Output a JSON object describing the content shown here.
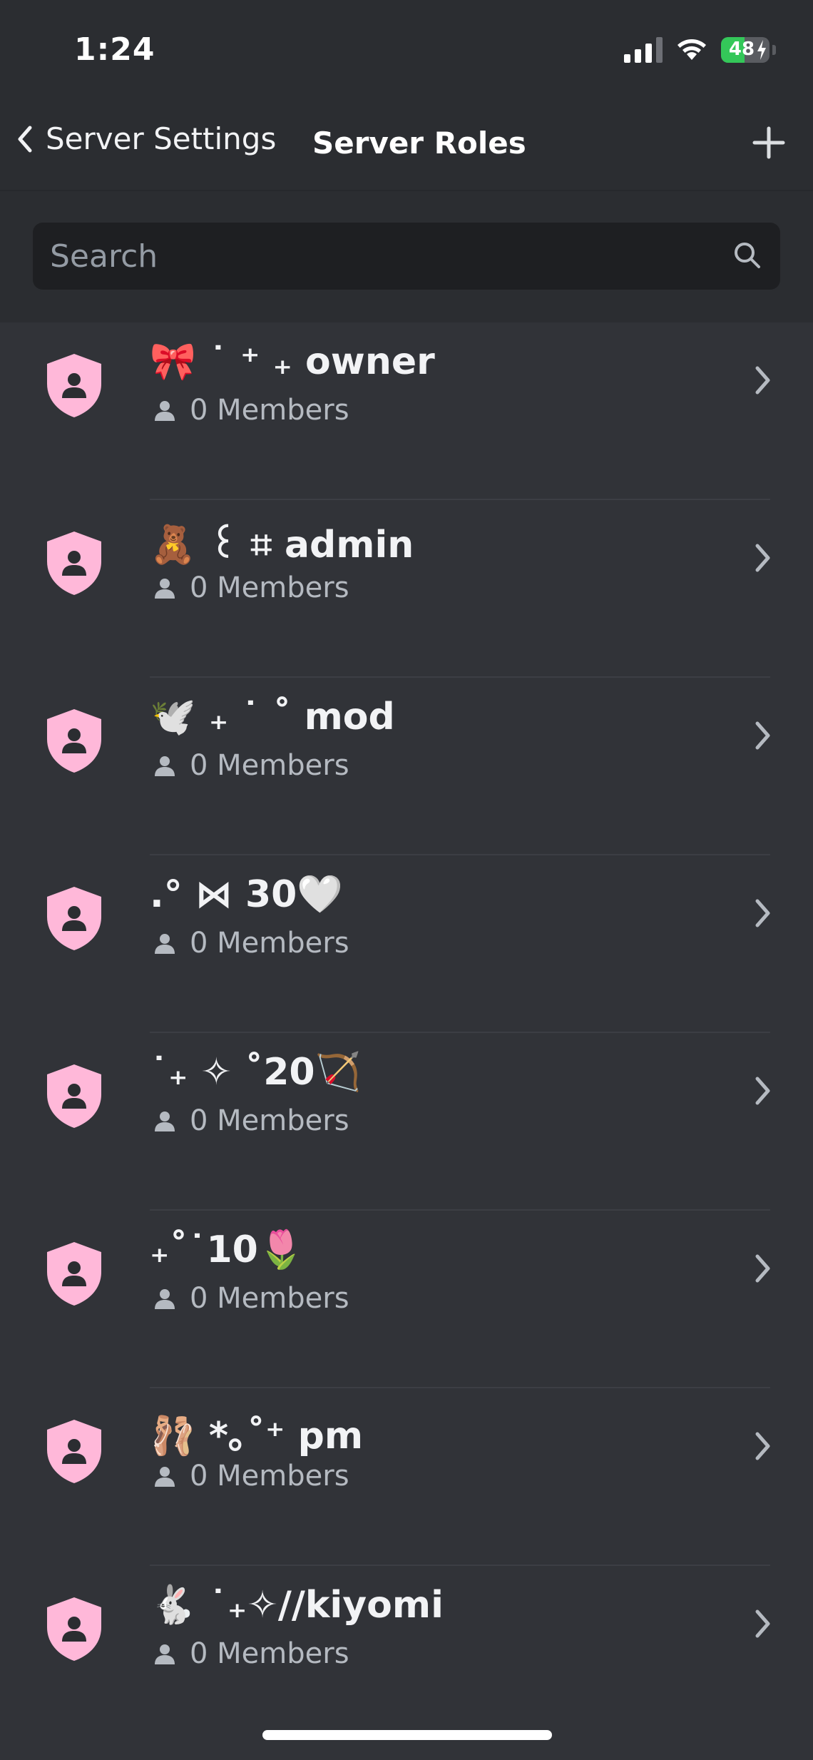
{
  "status": {
    "time": "1:24",
    "battery": "48",
    "battery_level": 0.48
  },
  "nav": {
    "back_label": "Server Settings",
    "title": "Server Roles"
  },
  "search": {
    "placeholder": "Search",
    "value": ""
  },
  "roles": [
    {
      "name": "🎀 ˙ ⁺ ₊ owner",
      "members": "0 Members",
      "color": "#ffb8d9"
    },
    {
      "name": "🧸 ꒰ ⌗ admin",
      "members": "0 Members",
      "color": "#ffb8d9"
    },
    {
      "name": "🕊️ ₊ ˙ ˚ mod",
      "members": "0 Members",
      "color": "#ffb8d9"
    },
    {
      "name": ".° ⋈ 30🤍",
      "members": "0 Members",
      "color": "#ffb8d9"
    },
    {
      "name": "˙₊ ✧ ˚20🏹",
      "members": "0 Members",
      "color": "#ffb8d9"
    },
    {
      "name": "₊˚˙10🌷",
      "members": "0 Members",
      "color": "#ffb8d9"
    },
    {
      "name": "🩰 *｡˚⁺ pm",
      "members": "0 Members",
      "color": "#ffb8d9"
    },
    {
      "name": "🐇 ˙₊✧//kiyomi",
      "members": "0 Members",
      "color": "#ffb8d9"
    }
  ]
}
